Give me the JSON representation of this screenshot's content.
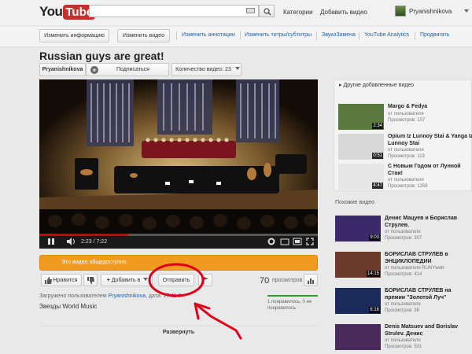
{
  "masthead": {
    "logo_you": "You",
    "logo_tube": "Tube",
    "search_value": "",
    "links": [
      "Категории",
      "Добавить видео"
    ],
    "user": "Pryanishnikova"
  },
  "creator_bar": {
    "buttons": [
      "Изменить информацию",
      "Изменить видео"
    ],
    "links": [
      "Изменить аннотации",
      "Изменить титры/субтитры",
      "ЗвукоЗамена",
      "YouTube Analytics",
      "Продвигать"
    ]
  },
  "video": {
    "title": "Russian guys are great!",
    "channel": "Pryanishnikova",
    "subscribe_label": "Подписаться",
    "video_count_label": "Количество видео: 23",
    "time": "2:23 / 7:22",
    "progress": 0.32,
    "public_notice": "Это видео общедоступно.",
    "like_label": "Нравится",
    "add_label": "Добавить в",
    "share_label": "Отправить",
    "view_count": "70",
    "views_label": "просмотров",
    "uploaded_prefix": "Загружено пользователем",
    "uploaded_user": "Pryanishnikova",
    "uploaded_date": ", дата: 17.11.2...",
    "description": "Звезды World Music",
    "like_stats": "1 понравилось, 0 не понравилось",
    "expand_label": "Развернуть"
  },
  "sidebar": {
    "other_heading": "Другие добавленные видео",
    "other_videos": [
      {
        "title": "Margo & Fedya",
        "by": "от пользователя",
        "views": "Просмотров: 157",
        "duration": "2:34",
        "thumb_color": "#5b7a3e"
      },
      {
        "title": "Opium Iz Lunnoy Stai & Yanga Iz Lunnoy Stai",
        "by": "от пользователя",
        "views": "Просмотров: 119",
        "duration": "0:51",
        "thumb_color": "#d8d8d8"
      },
      {
        "title": "С Новым Годом от Лунной Стаи!",
        "by": "от пользователя",
        "views": "Просмотров: 1258",
        "duration": "4:47",
        "thumb_color": "#e6e6e6"
      }
    ],
    "related_heading": "Похожие видео",
    "related_videos": [
      {
        "title": "Денис Мацуев и Борислав Струлев.",
        "by": "от пользователя",
        "views": "Просмотров: 307",
        "duration": "9:03",
        "thumb_color": "#3a2a6a"
      },
      {
        "title": "БОРИСЛАВ СТРУЛЕВ в ЭНЦИКЛОПЕДИИ",
        "by": "от пользователя RUNYweb",
        "views": "Просмотров: 414",
        "duration": "14:15",
        "thumb_color": "#6a3a2a"
      },
      {
        "title": "БОРИСЛАВ СТРУЛЕВ на премии \"Золотой Луч\"",
        "by": "от пользователя",
        "views": "Просмотров: 36",
        "duration": "6:16",
        "thumb_color": "#1a2a5a"
      },
      {
        "title": "Denis Matsuev and Borislav Strulev. Денис",
        "by": "от пользователя",
        "views": "Просмотров: 501",
        "duration": "",
        "thumb_color": "#4a2a5a"
      }
    ]
  },
  "colors": {
    "brand_red": "#c4302b",
    "link_blue": "#1c62b9",
    "public_orange": "#f09a1f",
    "annotation_red": "#e0001a"
  }
}
